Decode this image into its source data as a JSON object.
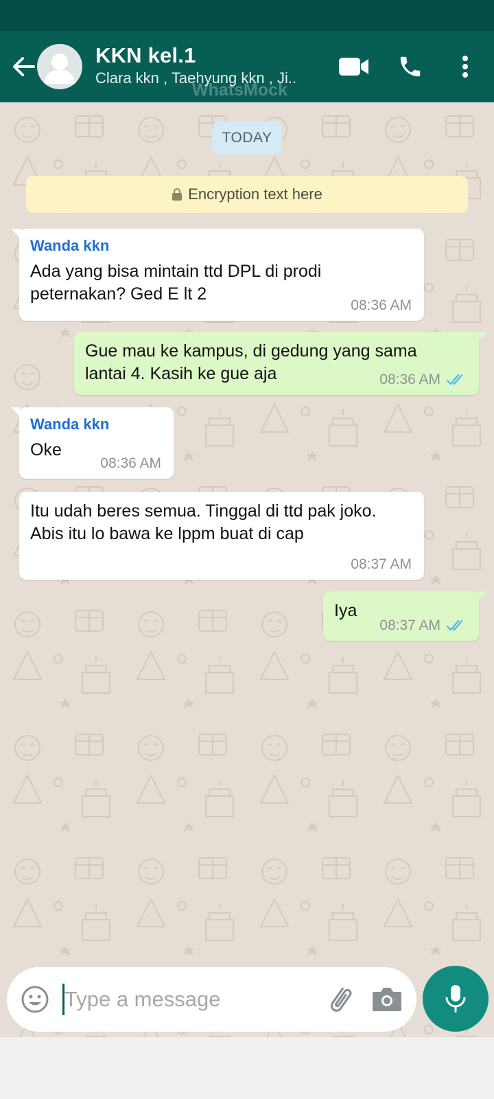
{
  "header": {
    "title": "KKN kel.1",
    "subtitle": "Clara kkn , Taehyung kkn , Ji..",
    "watermark": "WhatsMock"
  },
  "chat": {
    "date_label": "TODAY",
    "encryption_text": "Encryption text here",
    "messages": [
      {
        "direction": "in",
        "sender": "Wanda kkn",
        "text": "Ada yang bisa mintain ttd DPL di prodi peternakan? Ged E lt 2",
        "time": "08:36 AM"
      },
      {
        "direction": "out",
        "text": "Gue mau ke kampus, di gedung yang sama lantai 4. Kasih ke gue aja",
        "time": "08:36 AM",
        "status": "read"
      },
      {
        "direction": "in",
        "sender": "Wanda kkn",
        "text": "Oke",
        "time": "08:36 AM"
      },
      {
        "direction": "in",
        "text": "Itu udah beres semua. Tinggal di ttd pak joko. Abis itu lo bawa ke lppm buat di cap",
        "time": "08:37 AM"
      },
      {
        "direction": "out",
        "text": "Iya",
        "time": "08:37 AM",
        "status": "read"
      }
    ]
  },
  "composer": {
    "placeholder": "Type a message"
  },
  "colors": {
    "header": "#075e54",
    "status_bar": "#054d44",
    "outgoing_bubble": "#dcf8c6",
    "incoming_bubble": "#ffffff",
    "sender_name": "#1f6fcf",
    "read_ticks": "#4fb6ec",
    "mic_button": "#128c7e",
    "chat_background": "#e6ded5"
  },
  "icons": {
    "back": "arrow-left-icon",
    "video": "video-camera-icon",
    "call": "phone-icon",
    "menu": "more-vertical-icon",
    "lock": "lock-icon",
    "read": "double-check-icon",
    "emoji": "emoji-icon",
    "attach": "paperclip-icon",
    "camera": "camera-icon",
    "mic": "microphone-icon"
  }
}
